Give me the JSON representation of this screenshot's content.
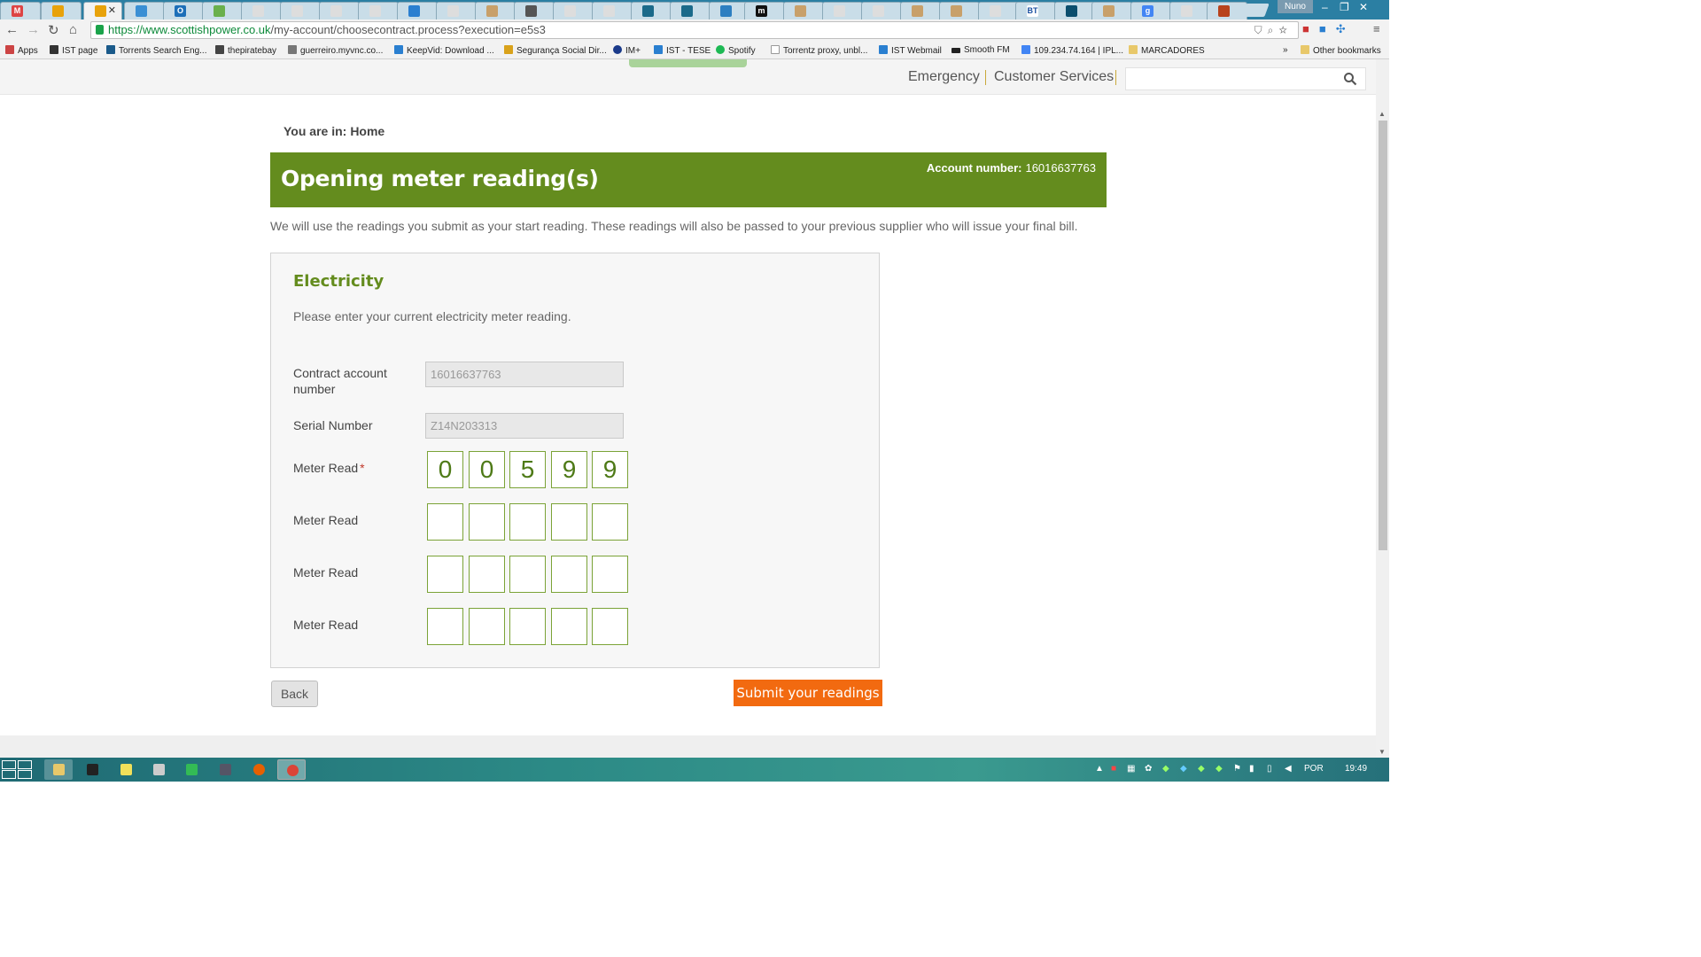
{
  "browser": {
    "user": "Nuno",
    "url_host": "https://www.scottishpower.co.uk",
    "url_path": "/my-account/choosecontract.process?execution=e5s3",
    "bookmarks": [
      "Apps",
      "IST page",
      "Torrents Search Eng...",
      "thepiratebay",
      "guerreiro.myvnc.co...",
      "KeepVid: Download ...",
      "Segurança Social Dir...",
      "IM+",
      "IST - TESE",
      "Spotify",
      "Torrentz proxy, unbl...",
      "IST Webmail",
      "Smooth FM",
      "109.234.74.164 | IPL...",
      "MARCADORES"
    ],
    "other_bookmarks": "Other bookmarks",
    "more_bookmarks": "»"
  },
  "header": {
    "emergency": "Emergency",
    "customer_services": "Customer Services",
    "search_placeholder": ""
  },
  "breadcrumb": {
    "prefix": "You are in:",
    "home": "Home"
  },
  "banner": {
    "title": "Opening meter reading(s)",
    "account_label": "Account number:",
    "account_number": "16016637763"
  },
  "intro": "We will use the readings you submit as your start reading. These readings will also be passed to your previous supplier who will issue your final bill.",
  "electricity": {
    "heading": "Electricity",
    "hint": "Please enter your current electricity meter reading.",
    "contract_label_line1": "Contract account",
    "contract_label_line2": "number",
    "contract_value": "16016637763",
    "serial_label": "Serial Number",
    "serial_value": "Z14N203313",
    "meter_label": "Meter Read",
    "required_mark": "*",
    "reads": [
      [
        "0",
        "0",
        "5",
        "9",
        "9"
      ],
      [
        "",
        "",
        "",
        "",
        ""
      ],
      [
        "",
        "",
        "",
        "",
        ""
      ],
      [
        "",
        "",
        "",
        "",
        ""
      ]
    ]
  },
  "actions": {
    "back": "Back",
    "submit": "Submit your readings"
  },
  "taskbar": {
    "language": "POR",
    "time": "19:49"
  }
}
